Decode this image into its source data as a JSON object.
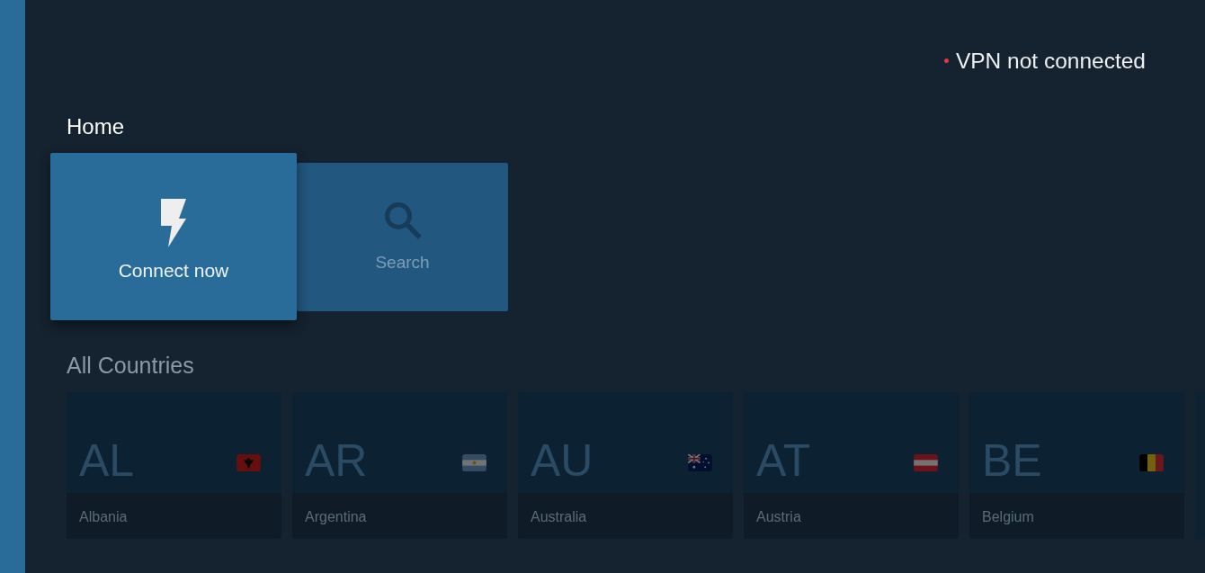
{
  "status": {
    "text": "VPN not connected",
    "connected": false
  },
  "home": {
    "title": "Home",
    "tiles": [
      {
        "kind": "connect",
        "label": "Connect now",
        "selected": true
      },
      {
        "kind": "search",
        "label": "Search",
        "selected": false
      }
    ]
  },
  "countries": {
    "title": "All Countries",
    "items": [
      {
        "code": "AL",
        "name": "Albania",
        "kind": "albania"
      },
      {
        "code": "AR",
        "name": "Argentina",
        "kind": "argentina"
      },
      {
        "code": "AU",
        "name": "Australia",
        "kind": "australia"
      },
      {
        "code": "AT",
        "name": "Austria",
        "kind": "austria"
      },
      {
        "code": "BE",
        "name": "Belgium",
        "kind": "belgium"
      }
    ]
  }
}
